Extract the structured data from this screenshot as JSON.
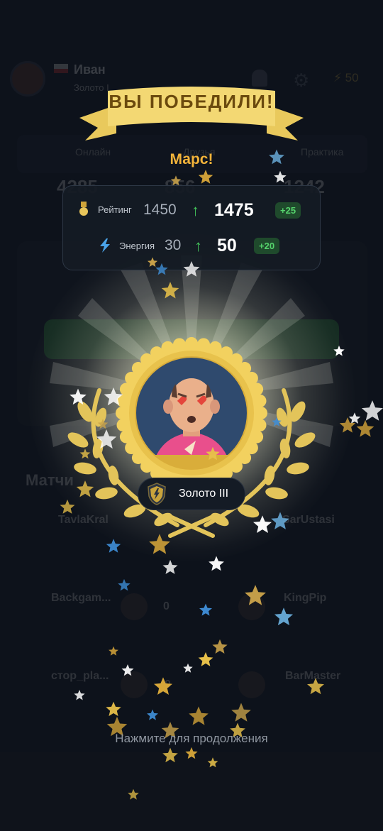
{
  "background_app": {
    "player_name": "Иван",
    "player_rank": "Золото I",
    "energy_value": "50",
    "tabs": [
      "Онлайн",
      "Друзья",
      "Практика"
    ],
    "stats": [
      "4285",
      "856",
      "1242"
    ],
    "section_title": "Матчи",
    "rows": [
      {
        "left": "TavlaKral",
        "right": "SarUstasi"
      },
      {
        "left": "Backgam...",
        "right": "KingPip"
      },
      {
        "left": "стор_pla...",
        "right": "BarMaster"
      }
    ]
  },
  "overlay": {
    "title": "ВЫ ПОБЕДИЛИ!",
    "opponent": "Марс!",
    "rating": {
      "label": "Рейтинг",
      "old": "1450",
      "new": "1475",
      "delta": "+25"
    },
    "energy": {
      "label": "Энергия",
      "old": "30",
      "new": "50",
      "delta": "+20"
    },
    "league": "Золото III",
    "continue_hint": "Нажмите для продолжения"
  },
  "colors": {
    "background": "#121923",
    "gold": "#f0d268",
    "accent_green": "#43c25a",
    "opponent_orange": "#f4b43a"
  },
  "icons": [
    "medal-icon",
    "lightning-icon",
    "arrow-up-icon",
    "shield-icon"
  ]
}
